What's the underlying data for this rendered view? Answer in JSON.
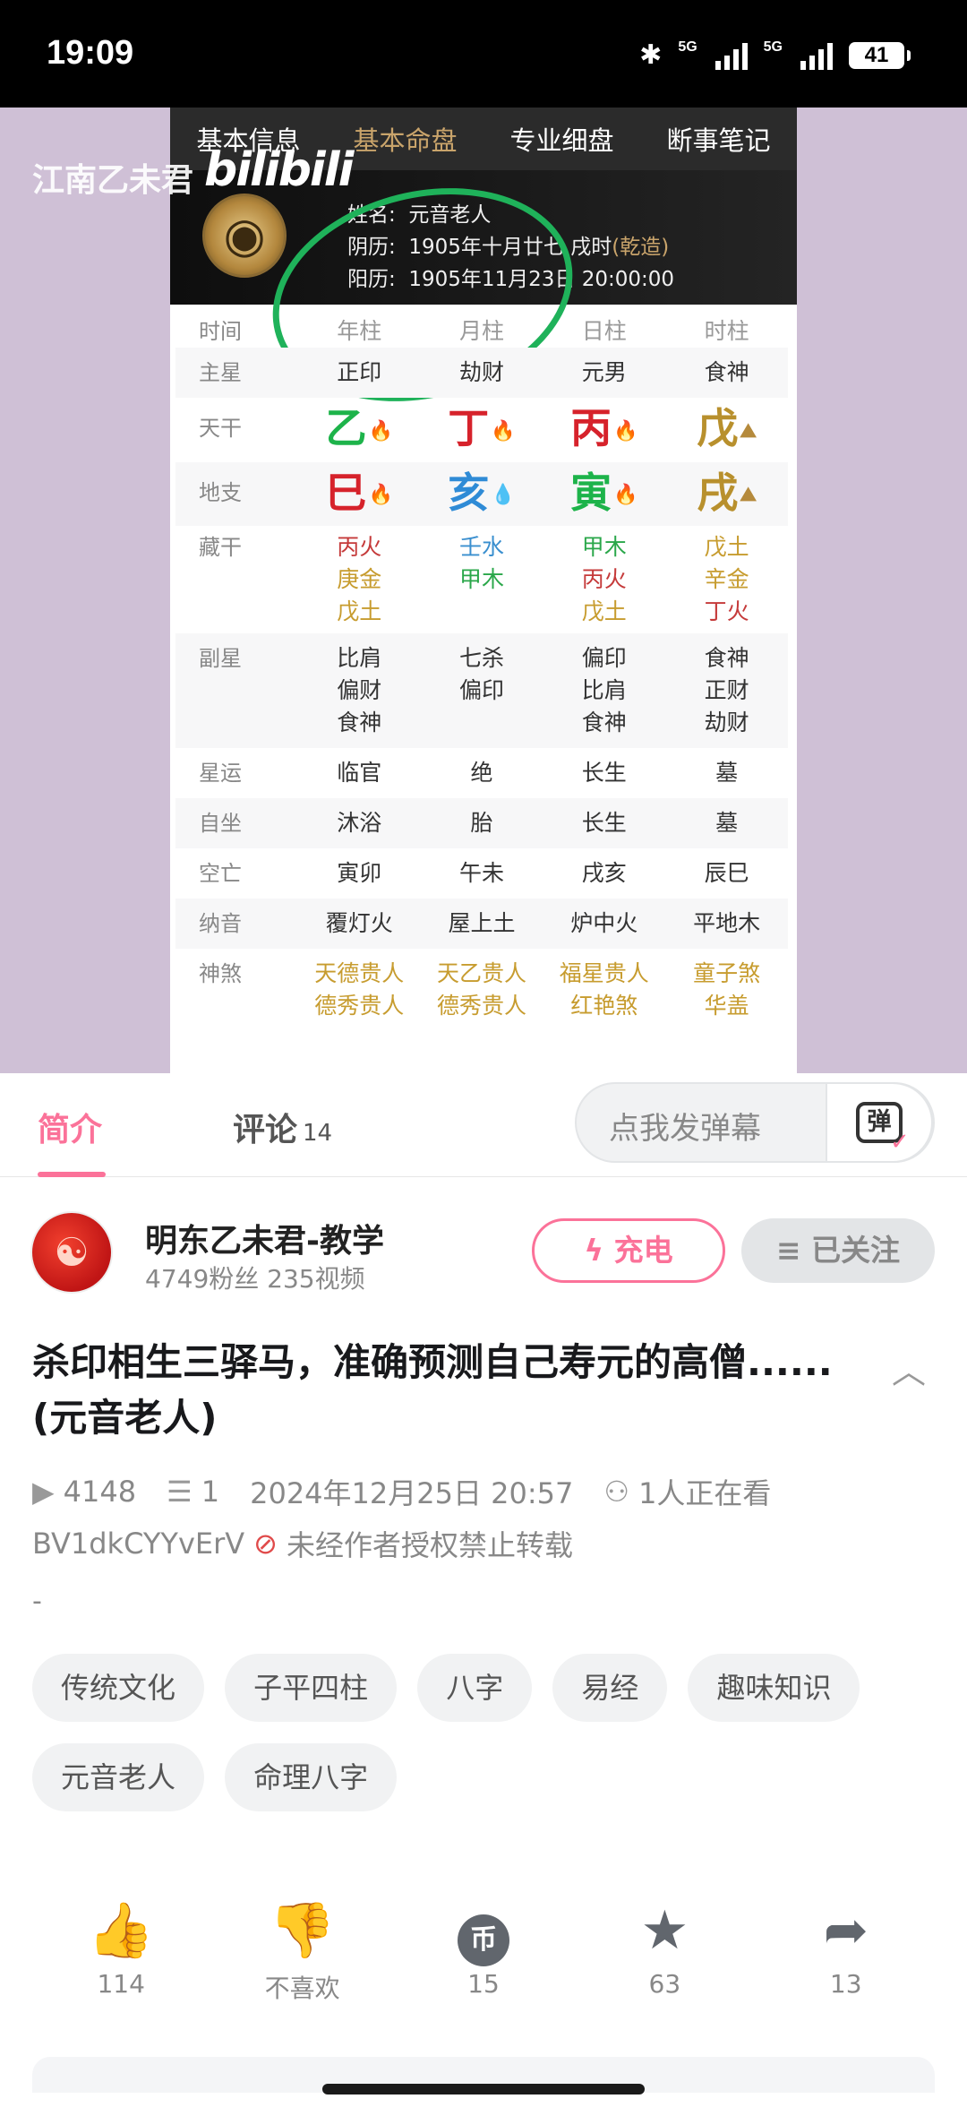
{
  "status_bar": {
    "time": "19:09",
    "signal1": "5G",
    "signal2": "5G",
    "battery": "41"
  },
  "video": {
    "watermark": "江南乙未君",
    "logo": "bilibili",
    "app_tabs": [
      "基本信息",
      "基本命盘",
      "专业细盘",
      "断事笔记"
    ],
    "active_tab": 1,
    "info": {
      "name_label": "姓名:",
      "name": "元音老人",
      "lunar_label": "阴历:",
      "lunar": "1905年十月廿七 戌时",
      "lunar_tag": "(乾造)",
      "solar_label": "阳历:",
      "solar": "1905年11月23日 20:00:00"
    },
    "chart": {
      "headers": [
        "时间",
        "年柱",
        "月柱",
        "日柱",
        "时柱"
      ],
      "main_star": {
        "label": "主星",
        "values": [
          "正印",
          "劫财",
          "元男",
          "食神"
        ]
      },
      "stems": {
        "label": "天干",
        "values": [
          "乙",
          "丁",
          "丙",
          "戊"
        ],
        "elements": [
          "wood",
          "fire",
          "fire",
          "earth"
        ]
      },
      "branches": {
        "label": "地支",
        "values": [
          "巳",
          "亥",
          "寅",
          "戌"
        ],
        "elements": [
          "fire",
          "water",
          "wood",
          "earth"
        ]
      },
      "hidden_stems": {
        "label": "藏干",
        "values": [
          [
            "丙火",
            "庚金",
            "戊土"
          ],
          [
            "壬水",
            "甲木"
          ],
          [
            "甲木",
            "丙火",
            "戊土"
          ],
          [
            "戊土",
            "辛金",
            "丁火"
          ]
        ]
      },
      "sub_star": {
        "label": "副星",
        "values": [
          [
            "比肩",
            "偏财",
            "食神"
          ],
          [
            "七杀",
            "偏印"
          ],
          [
            "偏印",
            "比肩",
            "食神"
          ],
          [
            "食神",
            "正财",
            "劫财"
          ]
        ]
      },
      "star_luck": {
        "label": "星运",
        "values": [
          "临官",
          "绝",
          "长生",
          "墓"
        ]
      },
      "self_seat": {
        "label": "自坐",
        "values": [
          "沐浴",
          "胎",
          "长生",
          "墓"
        ]
      },
      "void": {
        "label": "空亡",
        "values": [
          "寅卯",
          "午未",
          "戌亥",
          "辰巳"
        ]
      },
      "nayin": {
        "label": "纳音",
        "values": [
          "覆灯火",
          "屋上土",
          "炉中火",
          "平地木"
        ]
      },
      "shensha": {
        "label": "神煞",
        "values": [
          [
            "天德贵人",
            "德秀贵人"
          ],
          [
            "天乙贵人",
            "德秀贵人"
          ],
          [
            "福星贵人",
            "红艳煞"
          ],
          [
            "童子煞",
            "华盖"
          ]
        ]
      }
    }
  },
  "tabs": {
    "intro": "简介",
    "comments": "评论",
    "comments_count": "14",
    "danmaku_placeholder": "点我发弹幕",
    "danmaku_icon": "弹"
  },
  "uploader": {
    "name": "明东乙未君-教学",
    "stats": "4749粉丝   235视频",
    "charge": "充电",
    "follow": "已关注"
  },
  "video_info": {
    "title": "杀印相生三驿马，准确预测自己寿元的高僧......(元音老人)",
    "plays": "4148",
    "danmaku_count": "1",
    "date": "2024年12月25日 20:57",
    "watching": "1人正在看",
    "bvid": "BV1dkCYYvErV",
    "copyright": "未经作者授权禁止转载",
    "desc": "-"
  },
  "tags": [
    "传统文化",
    "子平四柱",
    "八字",
    "易经",
    "趣味知识",
    "元音老人",
    "命理八字"
  ],
  "actions": {
    "like": "114",
    "dislike": "不喜欢",
    "coin": "15",
    "favorite": "63",
    "share": "13"
  },
  "colors": {
    "accent": "#fb7299",
    "wood": "#1db34a",
    "fire": "#d6222b",
    "water": "#2f8bd6",
    "earth": "#b8902d",
    "highlight": "#1fb25a"
  }
}
